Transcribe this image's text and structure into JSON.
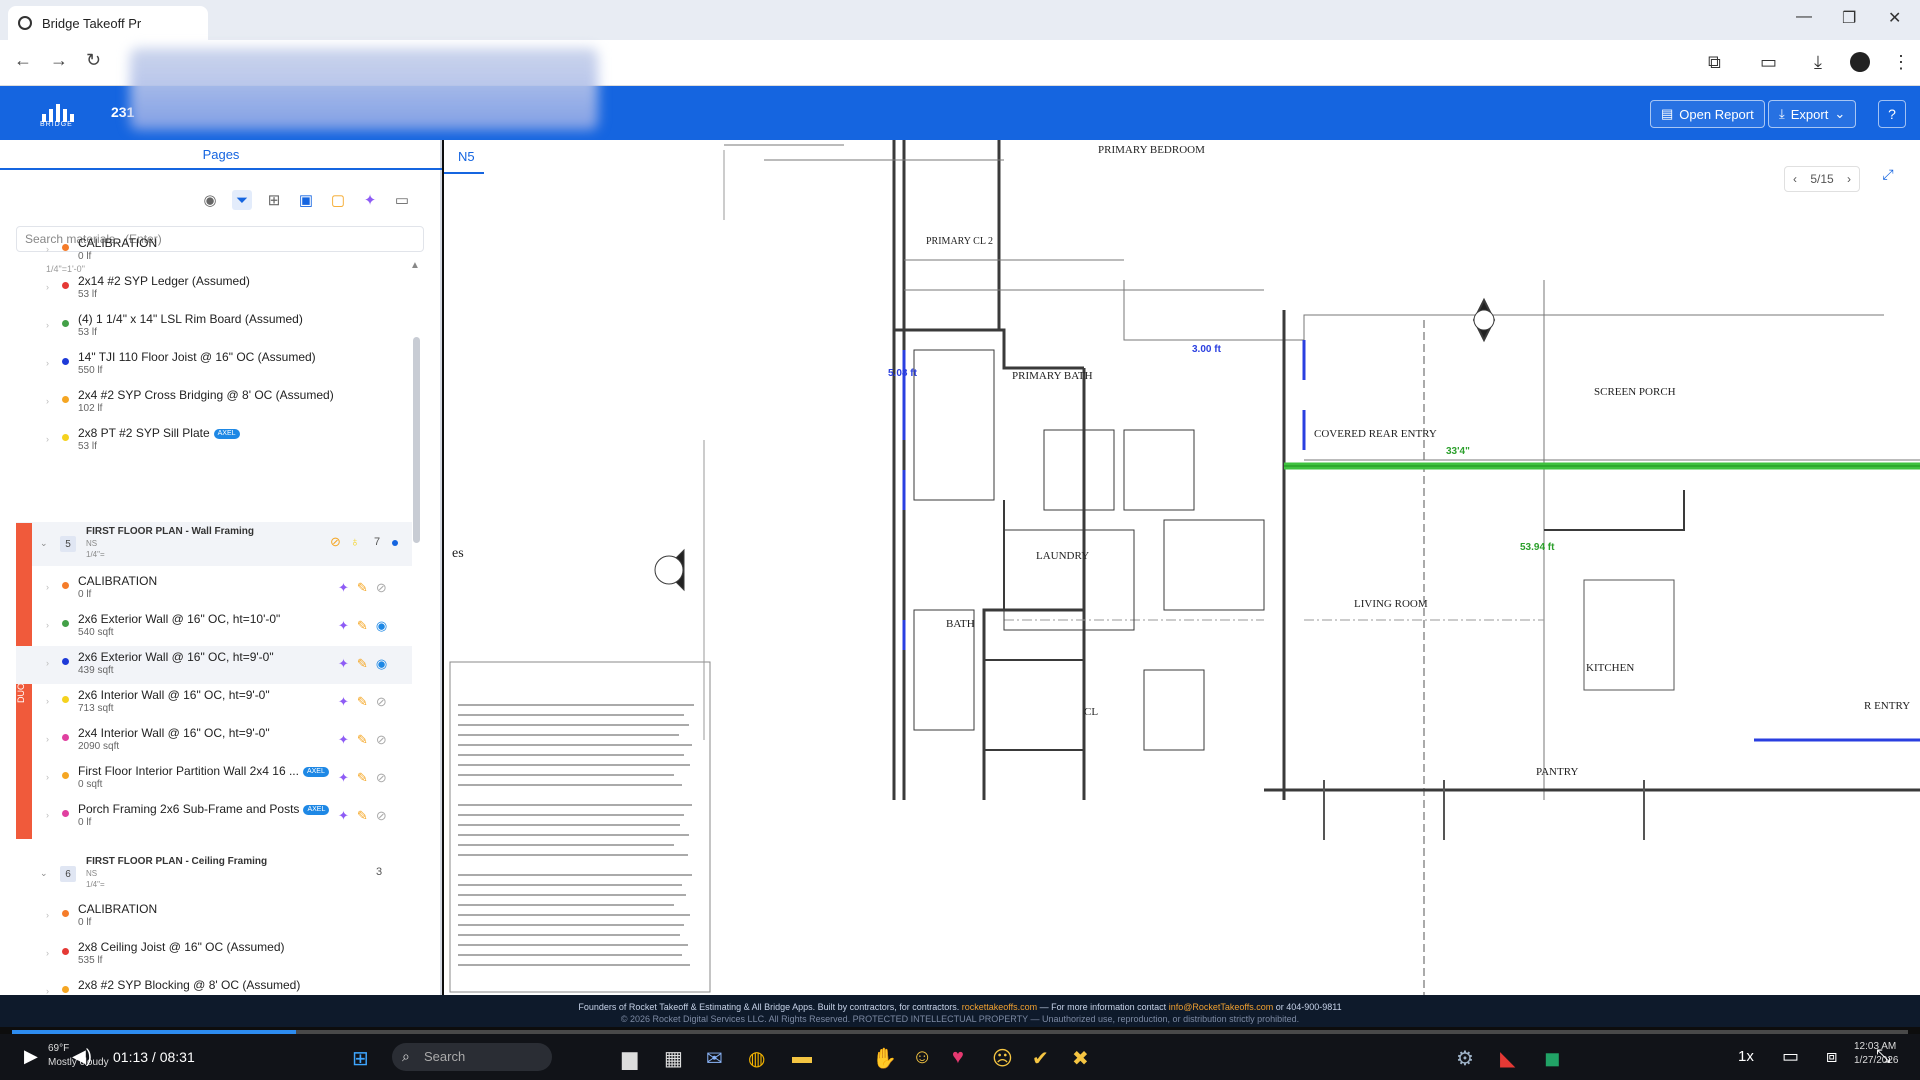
{
  "browser": {
    "tab_title": "Bridge Takeoff Pr"
  },
  "app": {
    "project_prefix": "231",
    "logo_text": "BRIDGE",
    "open_report": "Open Report",
    "export": "Export",
    "help": "?"
  },
  "sidebar": {
    "tab_label": "Pages",
    "search_placeholder": "Search materials.. (Enter)",
    "top_scale": "1/4\"=1'-0\"",
    "groups": [
      {
        "number": "5",
        "title": "FIRST FLOOR PLAN - Wall Framing",
        "sub": "NS",
        "scale": "1/4\"=",
        "count": "7"
      },
      {
        "number": "6",
        "title": "FIRST FLOOR PLAN - Ceiling Framing",
        "sub": "NS",
        "scale": "1/4\"=",
        "count": "3"
      }
    ],
    "items_a": [
      {
        "name": "CALIBRATION",
        "qty": "0 lf",
        "color": "#f57c2a"
      },
      {
        "name": "2x14 #2 SYP Ledger (Assumed)",
        "qty": "53 lf",
        "color": "#e53935"
      },
      {
        "name": "(4) 1 1/4\" x 14\" LSL Rim Board (Assumed)",
        "qty": "53 lf",
        "color": "#43a047"
      },
      {
        "name": "14\" TJI 110 Floor Joist @ 16\" OC (Assumed)",
        "qty": "550 lf",
        "color": "#1e3ad8"
      },
      {
        "name": "2x4 #2 SYP Cross Bridging @ 8' OC (Assumed)",
        "qty": "102 lf",
        "color": "#f5a623"
      },
      {
        "name": "2x8 PT #2 SYP Sill Plate",
        "qty": "53 lf",
        "color": "#f5d21e",
        "badge": "AXEL"
      }
    ],
    "items_b": [
      {
        "name": "CALIBRATION",
        "qty": "0 lf",
        "color": "#f57c2a"
      },
      {
        "name": "2x6 Exterior Wall @ 16\" OC, ht=10'-0\"",
        "qty": "540 sqft",
        "color": "#43a047"
      },
      {
        "name": "2x6 Exterior Wall @ 16\" OC, ht=9'-0\"",
        "qty": "439 sqft",
        "color": "#1e3ad8"
      },
      {
        "name": "2x6 Interior Wall @ 16\" OC, ht=9'-0\"",
        "qty": "713 sqft",
        "color": "#f5d21e"
      },
      {
        "name": "2x4 Interior Wall @ 16\" OC, ht=9'-0\"",
        "qty": "2090 sqft",
        "color": "#e040a0"
      },
      {
        "name": "First Floor Interior Partition Wall 2x4 16 ...",
        "qty": "0 sqft",
        "color": "#f5a623",
        "badge": "AXEL"
      },
      {
        "name": "Porch Framing 2x6 Sub-Frame and Posts",
        "qty": "0 lf",
        "color": "#e040a0",
        "badge": "AXEL"
      }
    ],
    "items_c": [
      {
        "name": "CALIBRATION",
        "qty": "0 lf",
        "color": "#f57c2a"
      },
      {
        "name": "2x8 Ceiling Joist @ 16\" OC (Assumed)",
        "qty": "535 lf",
        "color": "#e53935"
      },
      {
        "name": "2x8 #2 SYP Blocking @ 8' OC (Assumed)",
        "qty": "",
        "color": "#f5a623"
      }
    ],
    "side_label": "DUO00"
  },
  "viewer": {
    "tab_label": "N5",
    "page": "5/15",
    "rooms": {
      "primary_bedroom": "PRIMARY BEDROOM",
      "primary_cl": "PRIMARY CL 2",
      "primary_bath": "PRIMARY BATH",
      "covered_rear_entry": "COVERED REAR ENTRY",
      "screen_porch": "SCREEN PORCH",
      "laundry": "LAUNDRY",
      "living_room": "LIVING ROOM",
      "kitchen": "KITCHEN",
      "bath": "BATH",
      "cl": "CL",
      "pantry": "PANTRY",
      "entry": "R ENTRY"
    },
    "measurements": {
      "m1": "33'4\"",
      "m2": "53.94 ft",
      "m3": "5.08 ft",
      "m4": "3.00 ft"
    },
    "notes_title": "es"
  },
  "footer": {
    "line1a": "Founders of Rocket Takeoff & Estimating & All Bridge Apps. Built by contractors, for contractors.",
    "link1": "rockettakeoffs.com",
    "line1b": "— For more information contact",
    "link2": "info@RocketTakeoffs.com",
    "line1c": "or 404-900-9811",
    "line2": "© 2026 Rocket Digital Services LLC. All Rights Reserved. PROTECTED INTELLECTUAL PROPERTY — Unauthorized use, reproduction, or distribution strictly prohibited."
  },
  "player": {
    "time": "01:13 / 08:31",
    "progress": 0.15,
    "speed": "1x",
    "search": "Search",
    "temp": "69°F",
    "weather": "Mostly cloudy",
    "clock_time": "12:03 AM",
    "clock_date": "1/27/2026"
  }
}
